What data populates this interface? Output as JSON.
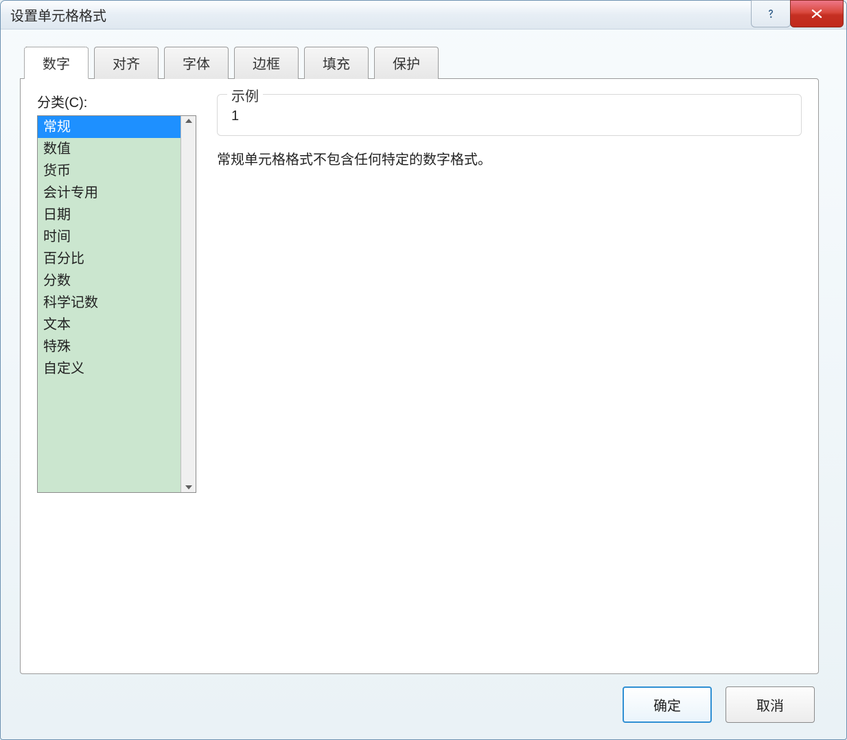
{
  "window": {
    "title": "设置单元格格式"
  },
  "tabs": {
    "number": "数字",
    "alignment": "对齐",
    "font": "字体",
    "border": "边框",
    "fill": "填充",
    "protection": "保护"
  },
  "category": {
    "label": "分类(C):",
    "items": [
      "常规",
      "数值",
      "货币",
      "会计专用",
      "日期",
      "时间",
      "百分比",
      "分数",
      "科学记数",
      "文本",
      "特殊",
      "自定义"
    ],
    "selected_index": 0
  },
  "example": {
    "legend": "示例",
    "value": "1"
  },
  "description": "常规单元格格式不包含任何特定的数字格式。",
  "buttons": {
    "ok": "确定",
    "cancel": "取消"
  }
}
